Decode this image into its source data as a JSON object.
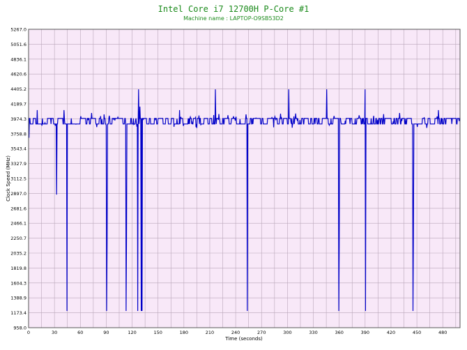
{
  "chart_data": {
    "type": "line",
    "title": "Intel Core i7 12700H P-Core #1",
    "subtitle": "Machine name : LAPTOP-O9SB53D2",
    "xlabel": "Time (seconds)",
    "ylabel": "Clock Speed (MHz)",
    "xlim": [
      0,
      500
    ],
    "ylim": [
      958.0,
      5267.0
    ],
    "x_ticks": [
      "0",
      "30",
      "60",
      "90",
      "120",
      "150",
      "180",
      "210",
      "240",
      "270",
      "300",
      "330",
      "360",
      "390",
      "420",
      "450",
      "480"
    ],
    "y_ticks": [
      "958.0",
      "1173.4",
      "1388.9",
      "1604.3",
      "1819.8",
      "2035.2",
      "2250.7",
      "2466.1",
      "2681.6",
      "2897.0",
      "3112.5",
      "3327.9",
      "3543.4",
      "3758.8",
      "3974.3",
      "4189.7",
      "4405.2",
      "4620.6",
      "4836.1",
      "5051.6",
      "5267.0"
    ],
    "grid": true,
    "series": [
      {
        "color": "#0000c8",
        "baseline_high": 3980,
        "baseline_low": 3900,
        "dips": [
          {
            "t": 0.7,
            "v": 3700
          },
          {
            "t": 32.5,
            "v": 2880
          },
          {
            "t": 44.5,
            "v": 1200
          },
          {
            "t": 90.5,
            "v": 1200
          },
          {
            "t": 91,
            "v": 2200
          },
          {
            "t": 113,
            "v": 1200
          },
          {
            "t": 113.5,
            "v": 2200
          },
          {
            "t": 126.5,
            "v": 1200
          },
          {
            "t": 130.5,
            "v": 1200
          },
          {
            "t": 131.5,
            "v": 1200
          },
          {
            "t": 253.5,
            "v": 1200
          },
          {
            "t": 359.5,
            "v": 1200
          },
          {
            "t": 360,
            "v": 2150
          },
          {
            "t": 390.5,
            "v": 1200
          },
          {
            "t": 445.5,
            "v": 1200
          },
          {
            "t": 446,
            "v": 2200
          }
        ],
        "spikes": [
          {
            "t": 127.5,
            "v": 4400
          },
          {
            "t": 129,
            "v": 4150
          },
          {
            "t": 216.5,
            "v": 4400
          },
          {
            "t": 301.5,
            "v": 4400
          },
          {
            "t": 345.5,
            "v": 4400
          },
          {
            "t": 390,
            "v": 4400
          },
          {
            "t": 10,
            "v": 4100
          },
          {
            "t": 41,
            "v": 4100
          },
          {
            "t": 175,
            "v": 4100
          },
          {
            "t": 475,
            "v": 4100
          }
        ]
      }
    ]
  }
}
